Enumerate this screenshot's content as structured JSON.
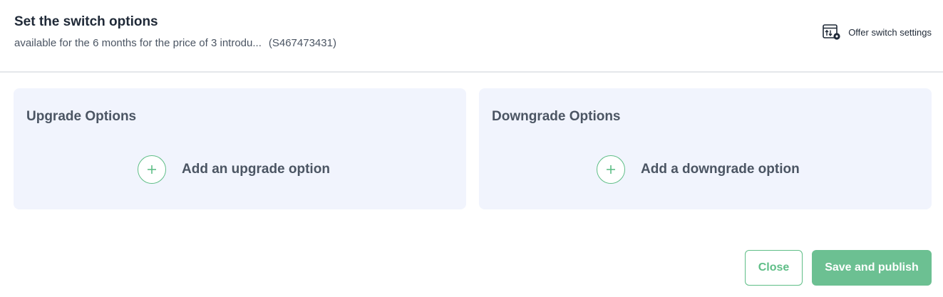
{
  "header": {
    "title": "Set the switch options",
    "subtitle": "available for the 6 months for the price of 3 introdu...",
    "offer_id": "(S467473431)",
    "settings_link": {
      "label": "Offer switch settings",
      "icon": "table-settings-icon"
    }
  },
  "panels": {
    "upgrade": {
      "title": "Upgrade Options",
      "add_label": "Add an upgrade option",
      "add_icon": "plus-icon"
    },
    "downgrade": {
      "title": "Downgrade Options",
      "add_label": "Add a downgrade option",
      "add_icon": "plus-icon"
    }
  },
  "footer": {
    "close_label": "Close",
    "save_label": "Save and publish"
  },
  "colors": {
    "accent": "#5fbe87",
    "primary_button": "#6cc092",
    "panel_background": "#f1f4fd",
    "divider": "#e5e7eb"
  }
}
